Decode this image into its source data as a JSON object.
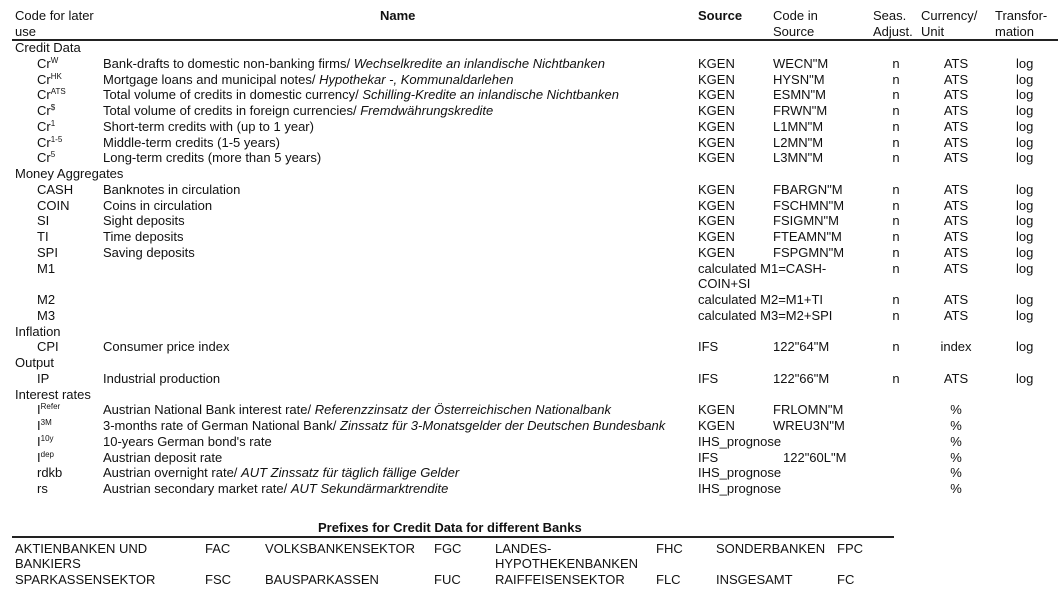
{
  "header": {
    "code": "Code for later use",
    "code_l1": "Code for later",
    "code_l2": "use",
    "name": "Name",
    "source": "Source",
    "code_in_source_l1": "Code in",
    "code_in_source_l2": "Source",
    "seas_l1": "Seas.",
    "seas_l2": "Adjust.",
    "currency_l1": "Currency/",
    "currency_l2": "Unit",
    "transform_l1": "Transfor-",
    "transform_l2": "mation"
  },
  "groups": [
    {
      "title": "Credit Data",
      "rows": [
        {
          "code": "Cr",
          "sup": "W",
          "name": "Bank-drafts to domestic non-banking firms/ ",
          "name_it": "Wechselkredite an inlandische Nichtbanken",
          "source": "KGEN",
          "src_code": "WECN\"M",
          "seas": "n",
          "unit": "ATS",
          "trans": "log"
        },
        {
          "code": "Cr",
          "sup": "HK",
          "name": "Mortgage loans and municipal notes/ ",
          "name_it": "Hypothekar -, Kommunaldarlehen",
          "source": "KGEN",
          "src_code": "HYSN\"M",
          "seas": "n",
          "unit": "ATS",
          "trans": "log"
        },
        {
          "code": "Cr",
          "sup": "ATS",
          "name": "Total volume of credits in domestic currency/ ",
          "name_it": "Schilling-Kredite an inlandische Nichtbanken",
          "source": "KGEN",
          "src_code": "ESMN\"M",
          "seas": "n",
          "unit": "ATS",
          "trans": "log"
        },
        {
          "code": "Cr",
          "sup": "$",
          "name": "Total volume of credits in foreign currencies/ ",
          "name_it": "Fremdwährungskredite",
          "source": "KGEN",
          "src_code": "FRWN\"M",
          "seas": "n",
          "unit": "ATS",
          "trans": "log"
        },
        {
          "code": "Cr",
          "sup": "1",
          "name": "Short-term credits with (up to 1 year)",
          "name_it": "",
          "source": "KGEN",
          "src_code": "L1MN\"M",
          "seas": "n",
          "unit": "ATS",
          "trans": "log"
        },
        {
          "code": "Cr",
          "sup": "1-5",
          "name": "Middle-term credits (1-5 years)",
          "name_it": "",
          "source": "KGEN",
          "src_code": "L2MN\"M",
          "seas": "n",
          "unit": "ATS",
          "trans": "log"
        },
        {
          "code": "Cr",
          "sup": "5",
          "name": "Long-term credits (more than 5 years)",
          "name_it": "",
          "source": "KGEN",
          "src_code": "L3MN\"M",
          "seas": "n",
          "unit": "ATS",
          "trans": "log"
        }
      ]
    },
    {
      "title": "Money Aggregates",
      "rows": [
        {
          "code": "CASH",
          "sup": "",
          "name": "Banknotes in circulation",
          "name_it": "",
          "source": "KGEN",
          "src_code": "FBARGN\"M",
          "seas": "n",
          "unit": "ATS",
          "trans": "log"
        },
        {
          "code": "COIN",
          "sup": "",
          "name": "Coins in circulation",
          "name_it": "",
          "source": "KGEN",
          "src_code": "FSCHMN\"M",
          "seas": "n",
          "unit": "ATS",
          "trans": "log"
        },
        {
          "code": "SI",
          "sup": "",
          "name": "Sight deposits",
          "name_it": "",
          "source": "KGEN",
          "src_code": "FSIGMN\"M",
          "seas": "n",
          "unit": "ATS",
          "trans": "log"
        },
        {
          "code": "TI",
          "sup": "",
          "name": "Time deposits",
          "name_it": "",
          "source": "KGEN",
          "src_code": "FTEAMN\"M",
          "seas": "n",
          "unit": "ATS",
          "trans": "log"
        },
        {
          "code": "SPI",
          "sup": "",
          "name": "Saving deposits",
          "name_it": "",
          "source": "KGEN",
          "src_code": "FSPGMN\"M",
          "seas": "n",
          "unit": "ATS",
          "trans": "log"
        },
        {
          "code": "M1",
          "sup": "",
          "name": "",
          "name_it": "",
          "source": "calculated M1=CASH-",
          "source_l2": "COIN+SI",
          "src_code": "",
          "seas": "n",
          "unit": "ATS",
          "trans": "log"
        },
        {
          "code": "M2",
          "sup": "",
          "name": "",
          "name_it": "",
          "source": "calculated M2=M1+TI",
          "src_code": "",
          "seas": "n",
          "unit": "ATS",
          "trans": "log"
        },
        {
          "code": "M3",
          "sup": "",
          "name": "",
          "name_it": "",
          "source": "calculated M3=M2+SPI",
          "src_code": "",
          "seas": "n",
          "unit": "ATS",
          "trans": "log"
        }
      ]
    },
    {
      "title": "Inflation",
      "rows": [
        {
          "code": "CPI",
          "sup": "",
          "name": "Consumer price index",
          "name_it": "",
          "source": "IFS",
          "src_code": "122\"64\"M",
          "seas": "n",
          "unit": "index",
          "trans": "log"
        }
      ]
    },
    {
      "title": "Output",
      "rows": [
        {
          "code": "IP",
          "sup": "",
          "name": "Industrial production",
          "name_it": "",
          "source": "IFS",
          "src_code": "122\"66\"M",
          "seas": "n",
          "unit": "ATS",
          "trans": "log"
        }
      ]
    },
    {
      "title": "Interest rates",
      "rows": [
        {
          "code": "I",
          "sup": "Refer",
          "name": "Austrian National Bank interest rate/ ",
          "name_it": "Referenzzinsatz der Österreichischen Nationalbank",
          "source": "KGEN",
          "src_code": "FRLOMN\"M",
          "seas": "",
          "unit": "%",
          "trans": ""
        },
        {
          "code": "I",
          "sup": "3M",
          "name": "3-months rate of German National Bank/ ",
          "name_it": "Zinssatz für 3-Monatsgelder der Deutschen Bundesbank",
          "source": "KGEN",
          "src_code": "WREU3N\"M",
          "seas": "",
          "unit": "%",
          "trans": ""
        },
        {
          "code": "I",
          "sup": "10y",
          "name": "10-years German bond's rate",
          "name_it": "",
          "source": "IHS_prognose",
          "src_code": "",
          "seas": "",
          "unit": "%",
          "trans": ""
        },
        {
          "code": "I",
          "sup": "dep",
          "name": "Austrian deposit rate",
          "name_it": "",
          "source": "IFS",
          "src_code": "122\"60L\"M",
          "seas": "",
          "unit": "%",
          "trans": ""
        },
        {
          "code": "rdkb",
          "sup": "",
          "name": "Austrian overnight rate/ ",
          "name_it": "AUT Zinssatz für täglich fällige Gelder",
          "source": "IHS_prognose",
          "src_code": "",
          "seas": "",
          "unit": "%",
          "trans": ""
        },
        {
          "code": "rs",
          "sup": "",
          "name": "Austrian secondary market rate/ ",
          "name_it": "AUT Sekundärmarktrendite",
          "source": "IHS_prognose",
          "src_code": "",
          "seas": "",
          "unit": "%",
          "trans": ""
        }
      ]
    }
  ],
  "prefixes": {
    "title": "Prefixes for Credit Data for different Banks",
    "rows": [
      [
        {
          "name": "AKTIENBANKEN UND",
          "name_l2": "BANKIERS",
          "code": "FAC"
        },
        {
          "name": "VOLKSBANKENSEKTOR",
          "name_l2": "",
          "code": "FGC"
        },
        {
          "name": "LANDES-",
          "name_l2": "HYPOTHEKENBANKEN",
          "code": "FHC"
        },
        {
          "name": "SONDERBANKEN",
          "name_l2": "",
          "code": "FPC"
        }
      ],
      [
        {
          "name": "SPARKASSENSEKTOR",
          "name_l2": "",
          "code": "FSC"
        },
        {
          "name": "BAUSPARKASSEN",
          "name_l2": "",
          "code": "FUC"
        },
        {
          "name": "RAIFFEISENSEKTOR",
          "name_l2": "",
          "code": "FLC"
        },
        {
          "name": "INSGESAMT",
          "name_l2": "",
          "code": "FC"
        }
      ]
    ]
  }
}
